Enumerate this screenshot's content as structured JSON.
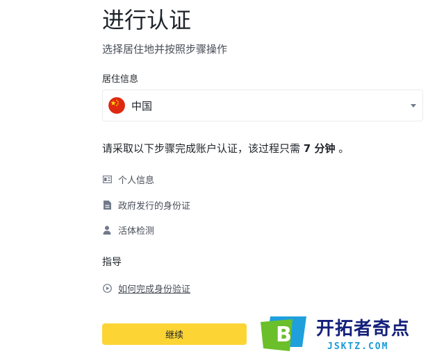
{
  "header": {
    "title": "进行认证",
    "subtitle": "选择居住地并按照步骤操作"
  },
  "residence": {
    "label": "居住信息",
    "selected_country": "中国",
    "flag_icon": "china-flag-icon"
  },
  "notice": {
    "prefix": "请采取以下步骤完成账户认证，该过程只需",
    "duration": "7 分钟",
    "suffix": "。"
  },
  "steps": [
    {
      "icon": "id-card-icon",
      "label": "个人信息"
    },
    {
      "icon": "document-icon",
      "label": "政府发行的身份证"
    },
    {
      "icon": "person-icon",
      "label": "活体检测"
    }
  ],
  "guide": {
    "title": "指导",
    "link_label": "如何完成身份验证",
    "link_icon": "play-circle-icon"
  },
  "continue_label": "继续",
  "watermark": {
    "logo_letter": "B",
    "name": "开拓者奇点",
    "site": "JSKTZ.COM"
  },
  "colors": {
    "accent": "#fcd535",
    "text_primary": "#1e2329",
    "text_secondary": "#474d57",
    "icon": "#707a8a"
  }
}
